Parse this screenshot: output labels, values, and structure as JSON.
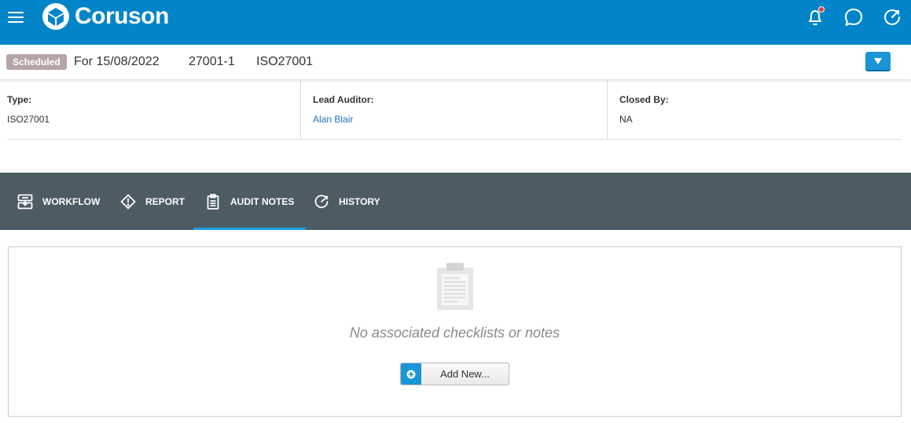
{
  "header": {
    "app_name": "Coruson",
    "brand_color": "#0185c8",
    "icons": [
      "menu-icon",
      "bell-icon",
      "chat-icon",
      "dashboard-icon"
    ]
  },
  "status": {
    "badge": "Scheduled",
    "date": "For 15/08/2022",
    "reference": "27001-1",
    "standard": "ISO27001"
  },
  "info": {
    "type_label": "Type:",
    "type_value": "ISO27001",
    "lead_auditor_label": "Lead Auditor:",
    "lead_auditor_value": "Alan Blair",
    "closed_by_label": "Closed By:",
    "closed_by_value": "NA"
  },
  "tabs": [
    {
      "label": "WORKFLOW",
      "icon": "workflow-icon"
    },
    {
      "label": "REPORT",
      "icon": "report-icon"
    },
    {
      "label": "AUDIT NOTES",
      "icon": "clipboard-icon",
      "active": true
    },
    {
      "label": "HISTORY",
      "icon": "history-icon"
    }
  ],
  "content": {
    "empty_message": "No associated checklists or notes",
    "add_button_label": "Add New..."
  }
}
